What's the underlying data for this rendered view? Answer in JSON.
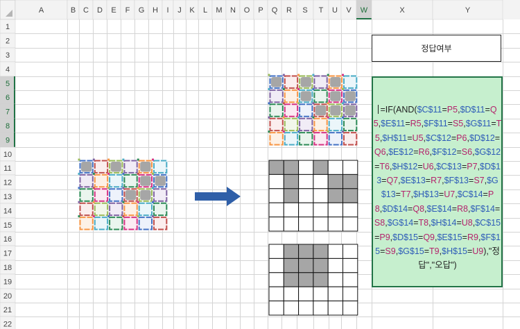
{
  "sheet": {
    "columns": [
      "A",
      "B",
      "C",
      "D",
      "E",
      "F",
      "G",
      "H",
      "I",
      "J",
      "K",
      "L",
      "M",
      "N",
      "O",
      "P",
      "Q",
      "R",
      "S",
      "T",
      "U",
      "V",
      "W",
      "X",
      "Y"
    ],
    "rows": [
      "1",
      "2",
      "3",
      "4",
      "5",
      "6",
      "7",
      "8",
      "9",
      "10",
      "11",
      "12",
      "13",
      "14",
      "15",
      "16",
      "17",
      "18",
      "19",
      "20",
      "21",
      "22"
    ],
    "selected_column": "W",
    "selected_rows": [
      "5",
      "6",
      "7",
      "8",
      "9"
    ]
  },
  "cells": {
    "answer_label": "정답여부"
  },
  "formula": {
    "tokens": [
      {
        "t": "=IF(AND(",
        "c": "plain"
      },
      {
        "t": "$C$11",
        "c": "p"
      },
      {
        "t": "=",
        "c": "plain"
      },
      {
        "t": "P5",
        "c": "g"
      },
      {
        "t": ",",
        "c": "plain"
      },
      {
        "t": "$D$11",
        "c": "p"
      },
      {
        "t": "=",
        "c": "plain"
      },
      {
        "t": "Q5",
        "c": "g"
      },
      {
        "t": ",",
        "c": "plain"
      },
      {
        "t": "$E$11",
        "c": "p"
      },
      {
        "t": "=",
        "c": "plain"
      },
      {
        "t": "R5",
        "c": "g"
      },
      {
        "t": ",",
        "c": "plain"
      },
      {
        "t": "$F$11",
        "c": "p"
      },
      {
        "t": "=",
        "c": "plain"
      },
      {
        "t": "S5",
        "c": "g"
      },
      {
        "t": ",",
        "c": "plain"
      },
      {
        "t": "$G$11",
        "c": "p"
      },
      {
        "t": "=",
        "c": "plain"
      },
      {
        "t": "T5",
        "c": "g"
      },
      {
        "t": ",",
        "c": "plain"
      },
      {
        "t": "$H$11",
        "c": "p"
      },
      {
        "t": "=",
        "c": "plain"
      },
      {
        "t": "U5",
        "c": "g"
      },
      {
        "t": ",",
        "c": "plain"
      },
      {
        "t": "$C$12",
        "c": "p"
      },
      {
        "t": "=",
        "c": "plain"
      },
      {
        "t": "P6",
        "c": "g"
      },
      {
        "t": ",",
        "c": "plain"
      },
      {
        "t": "$D$12",
        "c": "p"
      },
      {
        "t": "=",
        "c": "plain"
      },
      {
        "t": "Q6",
        "c": "g"
      },
      {
        "t": ",",
        "c": "plain"
      },
      {
        "t": "$E$12",
        "c": "p"
      },
      {
        "t": "=",
        "c": "plain"
      },
      {
        "t": "R6",
        "c": "g"
      },
      {
        "t": ",",
        "c": "plain"
      },
      {
        "t": "$F$12",
        "c": "p"
      },
      {
        "t": "=",
        "c": "plain"
      },
      {
        "t": "S6",
        "c": "g"
      },
      {
        "t": ",",
        "c": "plain"
      },
      {
        "t": "$G$12",
        "c": "p"
      },
      {
        "t": "=",
        "c": "plain"
      },
      {
        "t": "T6",
        "c": "g"
      },
      {
        "t": ",",
        "c": "plain"
      },
      {
        "t": "$H$12",
        "c": "p"
      },
      {
        "t": "=",
        "c": "plain"
      },
      {
        "t": "U6",
        "c": "g"
      },
      {
        "t": ",",
        "c": "plain"
      },
      {
        "t": "$C$13",
        "c": "p"
      },
      {
        "t": "=",
        "c": "plain"
      },
      {
        "t": "P7",
        "c": "g"
      },
      {
        "t": ",",
        "c": "plain"
      },
      {
        "t": "$D$13",
        "c": "p"
      },
      {
        "t": "=",
        "c": "plain"
      },
      {
        "t": "Q7",
        "c": "g"
      },
      {
        "t": ",",
        "c": "plain"
      },
      {
        "t": "$E$13",
        "c": "p"
      },
      {
        "t": "=",
        "c": "plain"
      },
      {
        "t": "R7",
        "c": "g"
      },
      {
        "t": ",",
        "c": "plain"
      },
      {
        "t": "$F$13",
        "c": "p"
      },
      {
        "t": "=",
        "c": "plain"
      },
      {
        "t": "S7",
        "c": "g"
      },
      {
        "t": ",",
        "c": "plain"
      },
      {
        "t": "$G$13",
        "c": "p"
      },
      {
        "t": "=",
        "c": "plain"
      },
      {
        "t": "T7",
        "c": "g"
      },
      {
        "t": ",",
        "c": "plain"
      },
      {
        "t": "$H$13",
        "c": "p"
      },
      {
        "t": "=",
        "c": "plain"
      },
      {
        "t": "U7",
        "c": "g"
      },
      {
        "t": ",",
        "c": "plain"
      },
      {
        "t": "$C$14",
        "c": "p"
      },
      {
        "t": "=",
        "c": "plain"
      },
      {
        "t": "P8",
        "c": "g"
      },
      {
        "t": ",",
        "c": "plain"
      },
      {
        "t": "$D$14",
        "c": "p"
      },
      {
        "t": "=",
        "c": "plain"
      },
      {
        "t": "Q8",
        "c": "g"
      },
      {
        "t": ",",
        "c": "plain"
      },
      {
        "t": "$E$14",
        "c": "p"
      },
      {
        "t": "=",
        "c": "plain"
      },
      {
        "t": "R8",
        "c": "g"
      },
      {
        "t": ",",
        "c": "plain"
      },
      {
        "t": "$F$14",
        "c": "p"
      },
      {
        "t": "=",
        "c": "plain"
      },
      {
        "t": "S8",
        "c": "g"
      },
      {
        "t": ",",
        "c": "plain"
      },
      {
        "t": "$G$14",
        "c": "p"
      },
      {
        "t": "=",
        "c": "plain"
      },
      {
        "t": "T8",
        "c": "g"
      },
      {
        "t": ",",
        "c": "plain"
      },
      {
        "t": "$H$14",
        "c": "p"
      },
      {
        "t": "=",
        "c": "plain"
      },
      {
        "t": "U8",
        "c": "g"
      },
      {
        "t": ",",
        "c": "plain"
      },
      {
        "t": "$C$15",
        "c": "p"
      },
      {
        "t": "=",
        "c": "plain"
      },
      {
        "t": "P9",
        "c": "g"
      },
      {
        "t": ",",
        "c": "plain"
      },
      {
        "t": "$D$15",
        "c": "p"
      },
      {
        "t": "=",
        "c": "plain"
      },
      {
        "t": "Q9",
        "c": "g"
      },
      {
        "t": ",",
        "c": "plain"
      },
      {
        "t": "$E$15",
        "c": "p"
      },
      {
        "t": "=",
        "c": "plain"
      },
      {
        "t": "R9",
        "c": "g"
      },
      {
        "t": ",",
        "c": "plain"
      },
      {
        "t": "$F$15",
        "c": "p"
      },
      {
        "t": "=",
        "c": "plain"
      },
      {
        "t": "S9",
        "c": "g"
      },
      {
        "t": ",",
        "c": "plain"
      },
      {
        "t": "$G$15",
        "c": "p"
      },
      {
        "t": "=",
        "c": "plain"
      },
      {
        "t": "T9",
        "c": "g"
      },
      {
        "t": ",",
        "c": "plain"
      },
      {
        "t": "$H$15",
        "c": "p"
      },
      {
        "t": "=",
        "c": "plain"
      },
      {
        "t": "U9",
        "c": "g"
      },
      {
        "t": "),\"정답\",\"오답\")",
        "c": "plain"
      }
    ]
  },
  "patterns": {
    "input_pattern": [
      [
        1,
        0,
        1,
        0,
        1,
        0
      ],
      [
        0,
        0,
        0,
        0,
        1,
        1
      ],
      [
        0,
        0,
        0,
        1,
        1,
        0
      ],
      [
        0,
        0,
        0,
        0,
        0,
        0
      ],
      [
        0,
        0,
        0,
        0,
        0,
        0
      ]
    ],
    "target_pattern": [
      [
        1,
        0,
        1,
        0,
        1,
        0
      ],
      [
        0,
        0,
        1,
        0,
        1,
        1
      ],
      [
        0,
        0,
        0,
        1,
        1,
        1
      ],
      [
        0,
        0,
        0,
        0,
        0,
        0
      ],
      [
        0,
        0,
        0,
        0,
        0,
        0
      ]
    ],
    "answer_a": [
      [
        1,
        1,
        0,
        1,
        0,
        0
      ],
      [
        0,
        1,
        0,
        0,
        1,
        1
      ],
      [
        0,
        1,
        0,
        0,
        1,
        1
      ],
      [
        0,
        0,
        0,
        0,
        0,
        0
      ],
      [
        0,
        0,
        0,
        0,
        0,
        0
      ]
    ],
    "answer_b": [
      [
        0,
        1,
        1,
        1,
        0,
        0
      ],
      [
        0,
        1,
        1,
        1,
        0,
        0
      ],
      [
        0,
        1,
        1,
        1,
        0,
        0
      ],
      [
        0,
        0,
        0,
        0,
        0,
        0
      ],
      [
        0,
        0,
        0,
        0,
        0,
        0
      ]
    ]
  },
  "colors": {
    "header_bg": "#f3f3f3",
    "header_selected_bg": "#d2d2d2",
    "gridline": "#d4d4d4",
    "selected_green": "#217346",
    "formula_bg": "#c6efce",
    "arrow_blue": "#2f5fa8",
    "filled_gray": "#a6a6a6"
  },
  "icons": [
    "right-arrow-icon"
  ]
}
